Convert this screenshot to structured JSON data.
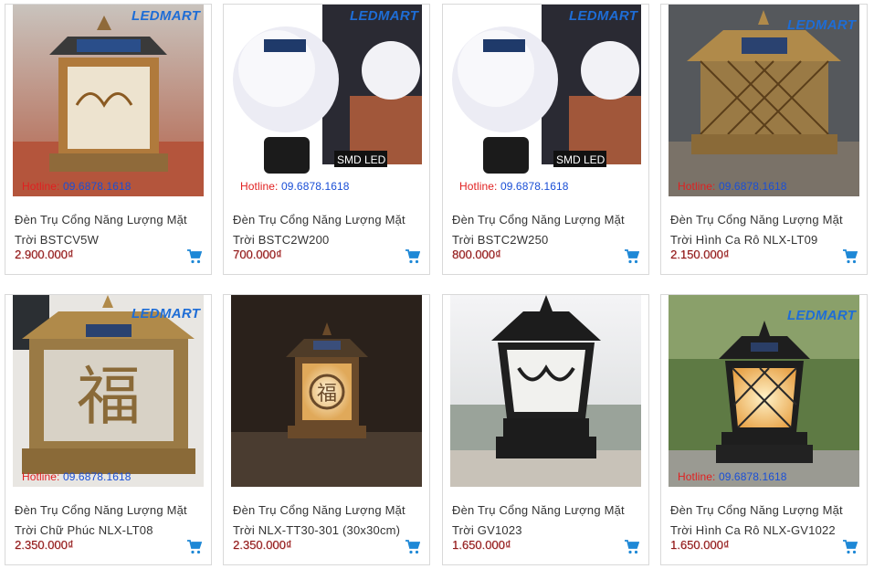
{
  "products": [
    {
      "title": "Đèn Trụ Cổng Năng Lượng Mặt Trời BSTCV5W",
      "price": "2.900.000₫",
      "hotline_label": "Hotline:",
      "hotline_number": "09.6878.1618",
      "watermark": "LEDMART",
      "badge": ""
    },
    {
      "title": "Đèn Trụ Cổng Năng Lượng Mặt Trời BSTC2W200",
      "price": "700.000₫",
      "hotline_label": "Hotline:",
      "hotline_number": "09.6878.1618",
      "watermark": "LEDMART",
      "badge": "SMD LED"
    },
    {
      "title": "Đèn Trụ Cổng Năng Lượng Mặt Trời BSTC2W250",
      "price": "800.000₫",
      "hotline_label": "Hotline:",
      "hotline_number": "09.6878.1618",
      "watermark": "LEDMART",
      "badge": "SMD LED"
    },
    {
      "title": "Đèn Trụ Cổng Năng Lượng Mặt Trời Hình Ca Rô NLX-LT09",
      "price": "2.150.000₫",
      "hotline_label": "Hotline:",
      "hotline_number": "09.6878.1618",
      "watermark": "LEDMART",
      "badge": ""
    },
    {
      "title": "Đèn Trụ Cổng Năng Lượng Mặt Trời Chữ Phúc NLX-LT08",
      "price": "2.350.000₫",
      "hotline_label": "Hotline:",
      "hotline_number": "09.6878.1618",
      "watermark": "LEDMART",
      "badge": ""
    },
    {
      "title": "Đèn Trụ Cổng Năng Lượng Mặt Trời NLX-TT30-301 (30x30cm)",
      "price": "2.350.000₫",
      "hotline_label": "",
      "hotline_number": "",
      "watermark": "",
      "badge": ""
    },
    {
      "title": "Đèn Trụ Cổng Năng Lượng Mặt Trời GV1023",
      "price": "1.650.000₫",
      "hotline_label": "",
      "hotline_number": "",
      "watermark": "",
      "badge": ""
    },
    {
      "title": "Đèn Trụ Cổng Năng Lượng Mặt Trời Hình Ca Rô NLX-GV1022",
      "price": "1.650.000₫",
      "hotline_label": "Hotline:",
      "hotline_number": "09.6878.1618",
      "watermark": "LEDMART",
      "badge": ""
    }
  ],
  "icons": {
    "cart": "shopping-cart-icon"
  },
  "colors": {
    "price": "#8b1a1a",
    "cart": "#1e88d6",
    "hotline_label": "#e02020",
    "hotline_number": "#1a4fd6",
    "border": "#d9d9d9"
  }
}
